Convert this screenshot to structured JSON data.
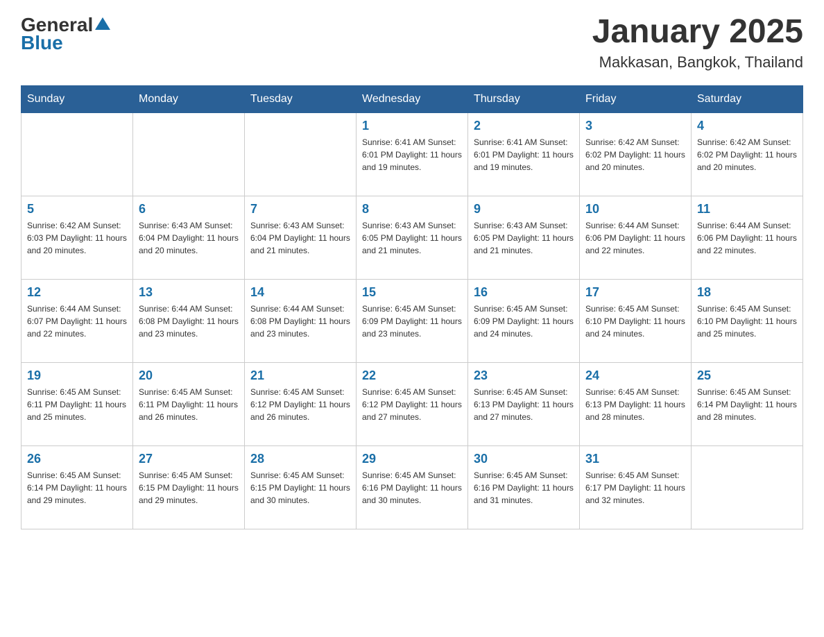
{
  "logo": {
    "general": "General",
    "blue": "Blue",
    "tagline": "Blue"
  },
  "title": {
    "month_year": "January 2025",
    "location": "Makkasan, Bangkok, Thailand"
  },
  "weekdays": [
    "Sunday",
    "Monday",
    "Tuesday",
    "Wednesday",
    "Thursday",
    "Friday",
    "Saturday"
  ],
  "weeks": [
    [
      {
        "day": "",
        "info": ""
      },
      {
        "day": "",
        "info": ""
      },
      {
        "day": "",
        "info": ""
      },
      {
        "day": "1",
        "info": "Sunrise: 6:41 AM\nSunset: 6:01 PM\nDaylight: 11 hours\nand 19 minutes."
      },
      {
        "day": "2",
        "info": "Sunrise: 6:41 AM\nSunset: 6:01 PM\nDaylight: 11 hours\nand 19 minutes."
      },
      {
        "day": "3",
        "info": "Sunrise: 6:42 AM\nSunset: 6:02 PM\nDaylight: 11 hours\nand 20 minutes."
      },
      {
        "day": "4",
        "info": "Sunrise: 6:42 AM\nSunset: 6:02 PM\nDaylight: 11 hours\nand 20 minutes."
      }
    ],
    [
      {
        "day": "5",
        "info": "Sunrise: 6:42 AM\nSunset: 6:03 PM\nDaylight: 11 hours\nand 20 minutes."
      },
      {
        "day": "6",
        "info": "Sunrise: 6:43 AM\nSunset: 6:04 PM\nDaylight: 11 hours\nand 20 minutes."
      },
      {
        "day": "7",
        "info": "Sunrise: 6:43 AM\nSunset: 6:04 PM\nDaylight: 11 hours\nand 21 minutes."
      },
      {
        "day": "8",
        "info": "Sunrise: 6:43 AM\nSunset: 6:05 PM\nDaylight: 11 hours\nand 21 minutes."
      },
      {
        "day": "9",
        "info": "Sunrise: 6:43 AM\nSunset: 6:05 PM\nDaylight: 11 hours\nand 21 minutes."
      },
      {
        "day": "10",
        "info": "Sunrise: 6:44 AM\nSunset: 6:06 PM\nDaylight: 11 hours\nand 22 minutes."
      },
      {
        "day": "11",
        "info": "Sunrise: 6:44 AM\nSunset: 6:06 PM\nDaylight: 11 hours\nand 22 minutes."
      }
    ],
    [
      {
        "day": "12",
        "info": "Sunrise: 6:44 AM\nSunset: 6:07 PM\nDaylight: 11 hours\nand 22 minutes."
      },
      {
        "day": "13",
        "info": "Sunrise: 6:44 AM\nSunset: 6:08 PM\nDaylight: 11 hours\nand 23 minutes."
      },
      {
        "day": "14",
        "info": "Sunrise: 6:44 AM\nSunset: 6:08 PM\nDaylight: 11 hours\nand 23 minutes."
      },
      {
        "day": "15",
        "info": "Sunrise: 6:45 AM\nSunset: 6:09 PM\nDaylight: 11 hours\nand 23 minutes."
      },
      {
        "day": "16",
        "info": "Sunrise: 6:45 AM\nSunset: 6:09 PM\nDaylight: 11 hours\nand 24 minutes."
      },
      {
        "day": "17",
        "info": "Sunrise: 6:45 AM\nSunset: 6:10 PM\nDaylight: 11 hours\nand 24 minutes."
      },
      {
        "day": "18",
        "info": "Sunrise: 6:45 AM\nSunset: 6:10 PM\nDaylight: 11 hours\nand 25 minutes."
      }
    ],
    [
      {
        "day": "19",
        "info": "Sunrise: 6:45 AM\nSunset: 6:11 PM\nDaylight: 11 hours\nand 25 minutes."
      },
      {
        "day": "20",
        "info": "Sunrise: 6:45 AM\nSunset: 6:11 PM\nDaylight: 11 hours\nand 26 minutes."
      },
      {
        "day": "21",
        "info": "Sunrise: 6:45 AM\nSunset: 6:12 PM\nDaylight: 11 hours\nand 26 minutes."
      },
      {
        "day": "22",
        "info": "Sunrise: 6:45 AM\nSunset: 6:12 PM\nDaylight: 11 hours\nand 27 minutes."
      },
      {
        "day": "23",
        "info": "Sunrise: 6:45 AM\nSunset: 6:13 PM\nDaylight: 11 hours\nand 27 minutes."
      },
      {
        "day": "24",
        "info": "Sunrise: 6:45 AM\nSunset: 6:13 PM\nDaylight: 11 hours\nand 28 minutes."
      },
      {
        "day": "25",
        "info": "Sunrise: 6:45 AM\nSunset: 6:14 PM\nDaylight: 11 hours\nand 28 minutes."
      }
    ],
    [
      {
        "day": "26",
        "info": "Sunrise: 6:45 AM\nSunset: 6:14 PM\nDaylight: 11 hours\nand 29 minutes."
      },
      {
        "day": "27",
        "info": "Sunrise: 6:45 AM\nSunset: 6:15 PM\nDaylight: 11 hours\nand 29 minutes."
      },
      {
        "day": "28",
        "info": "Sunrise: 6:45 AM\nSunset: 6:15 PM\nDaylight: 11 hours\nand 30 minutes."
      },
      {
        "day": "29",
        "info": "Sunrise: 6:45 AM\nSunset: 6:16 PM\nDaylight: 11 hours\nand 30 minutes."
      },
      {
        "day": "30",
        "info": "Sunrise: 6:45 AM\nSunset: 6:16 PM\nDaylight: 11 hours\nand 31 minutes."
      },
      {
        "day": "31",
        "info": "Sunrise: 6:45 AM\nSunset: 6:17 PM\nDaylight: 11 hours\nand 32 minutes."
      },
      {
        "day": "",
        "info": ""
      }
    ]
  ]
}
